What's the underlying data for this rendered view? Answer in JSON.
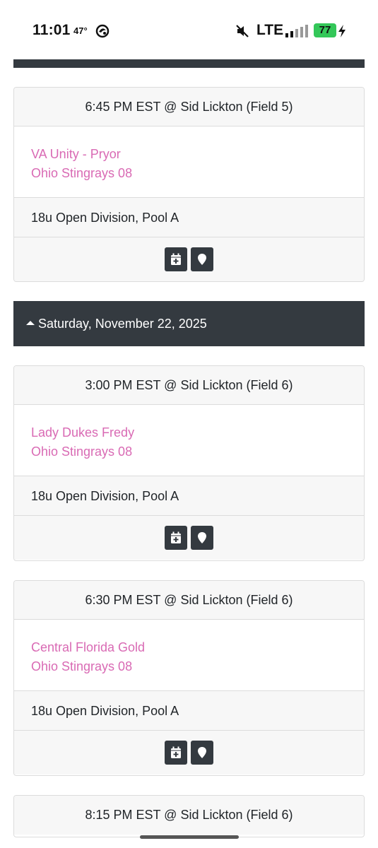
{
  "status_bar": {
    "time": "11:01",
    "temperature": "47°",
    "network": "LTE",
    "battery": "77",
    "battery_color": "#34c759"
  },
  "colors": {
    "header_bg": "#343a40",
    "team_link": "#d96ab4",
    "card_muted_bg": "#f7f7f7"
  },
  "games_top": [
    {
      "time_location": "6:45 PM EST @ Sid Lickton (Field 5)",
      "team1": "VA Unity - Pryor",
      "team2": "Ohio Stingrays 08",
      "division": "18u Open Division, Pool A",
      "actions": [
        "calendar-plus-icon",
        "map-marker-icon"
      ]
    }
  ],
  "day_header": {
    "label": "Saturday, November 22, 2025"
  },
  "games_day": [
    {
      "time_location": "3:00 PM EST @ Sid Lickton (Field 6)",
      "team1": "Lady Dukes Fredy",
      "team2": "Ohio Stingrays 08",
      "division": "18u Open Division, Pool A"
    },
    {
      "time_location": "6:30 PM EST @ Sid Lickton (Field 6)",
      "team1": "Central Florida Gold",
      "team2": "Ohio Stingrays 08",
      "division": "18u Open Division, Pool A"
    },
    {
      "time_location": "8:15 PM EST @ Sid Lickton (Field 6)"
    }
  ]
}
